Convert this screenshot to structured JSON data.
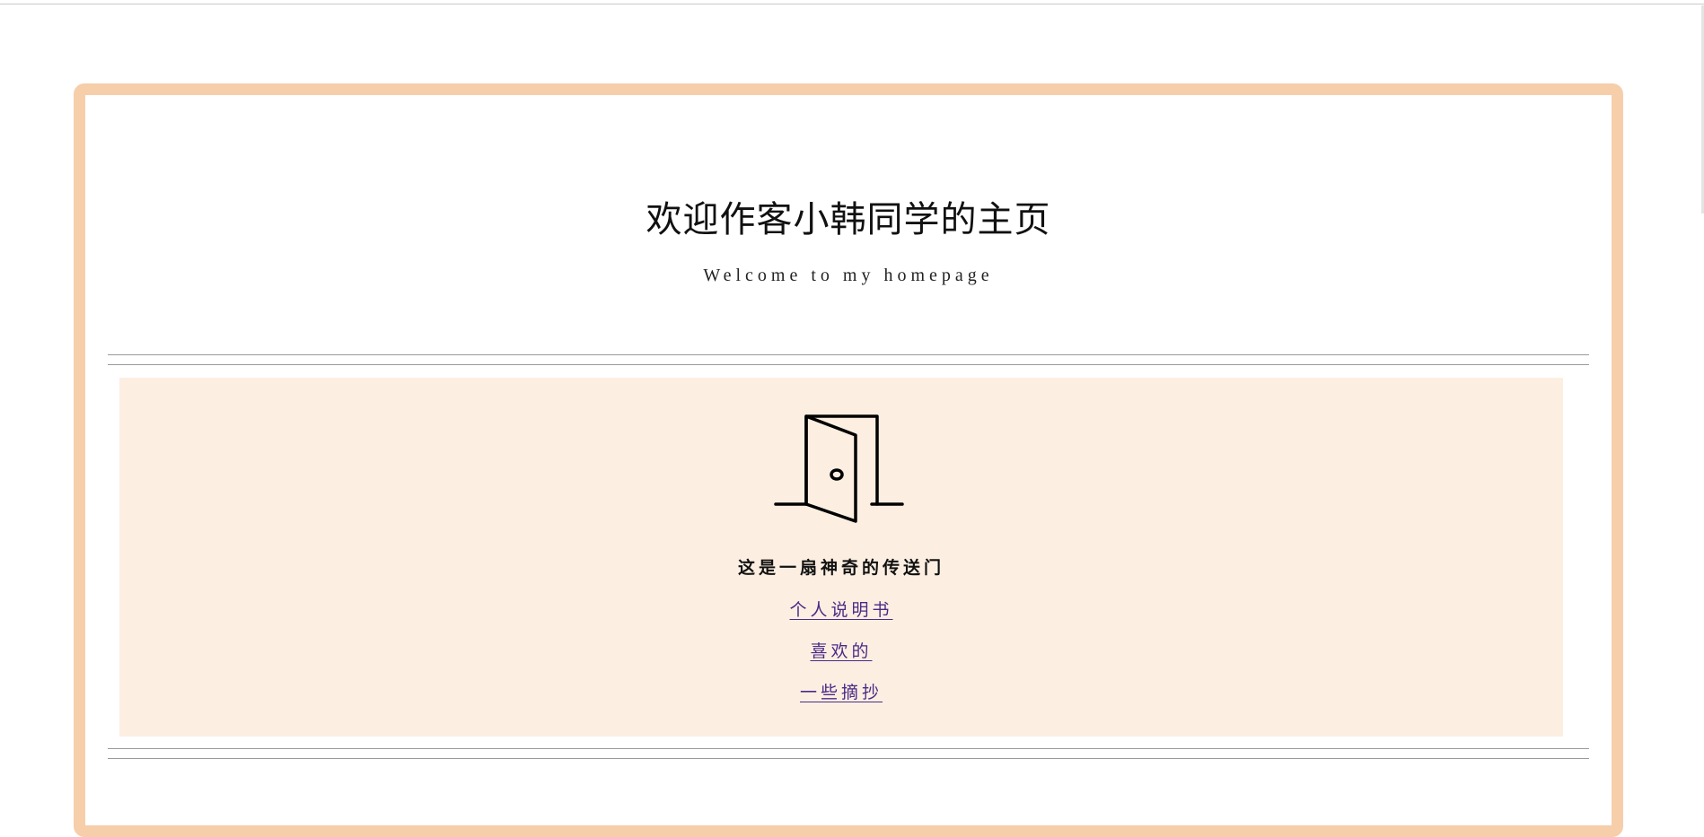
{
  "header": {
    "title": "欢迎作客小韩同学的主页",
    "subtitle": "Welcome to my homepage"
  },
  "portal": {
    "icon": "open-door-icon",
    "caption": "这是一扇神奇的传送门",
    "links": [
      {
        "label": "个人说明书"
      },
      {
        "label": "喜欢的"
      },
      {
        "label": "一些摘抄"
      }
    ]
  },
  "colors": {
    "frame_border": "#f6ceaa",
    "portal_background": "#fcefe2",
    "link": "#4b2a86",
    "text": "#111111"
  }
}
